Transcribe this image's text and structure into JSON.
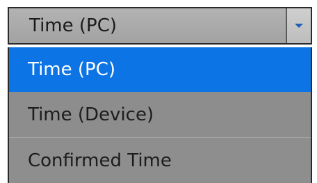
{
  "dropdown": {
    "selected_value": "Time (PC)",
    "options": [
      {
        "label": "Time (PC)",
        "selected": true
      },
      {
        "label": "Time (Device)",
        "selected": false
      },
      {
        "label": "Confirmed Time",
        "selected": false
      }
    ],
    "icon": "chevron-down-icon",
    "colors": {
      "highlight": "#0d74e6",
      "list_background": "#8f8f8f",
      "header_background": "#adadad"
    }
  }
}
